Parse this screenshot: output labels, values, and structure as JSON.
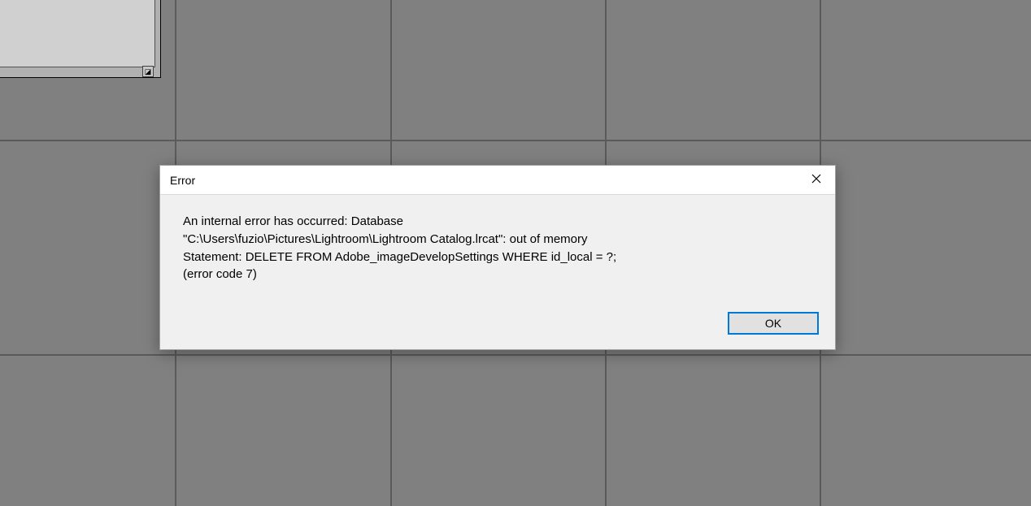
{
  "dialog": {
    "title": "Error",
    "message_line1": "An internal error has occurred: Database",
    "message_line2": "\"C:\\Users\\fuzio\\Pictures\\Lightroom\\Lightroom Catalog.lrcat\": out of memory",
    "message_line3": "  Statement: DELETE FROM Adobe_imageDevelopSettings WHERE id_local = ?;",
    "message_line4": "(error code 7)",
    "ok_label": "OK"
  }
}
